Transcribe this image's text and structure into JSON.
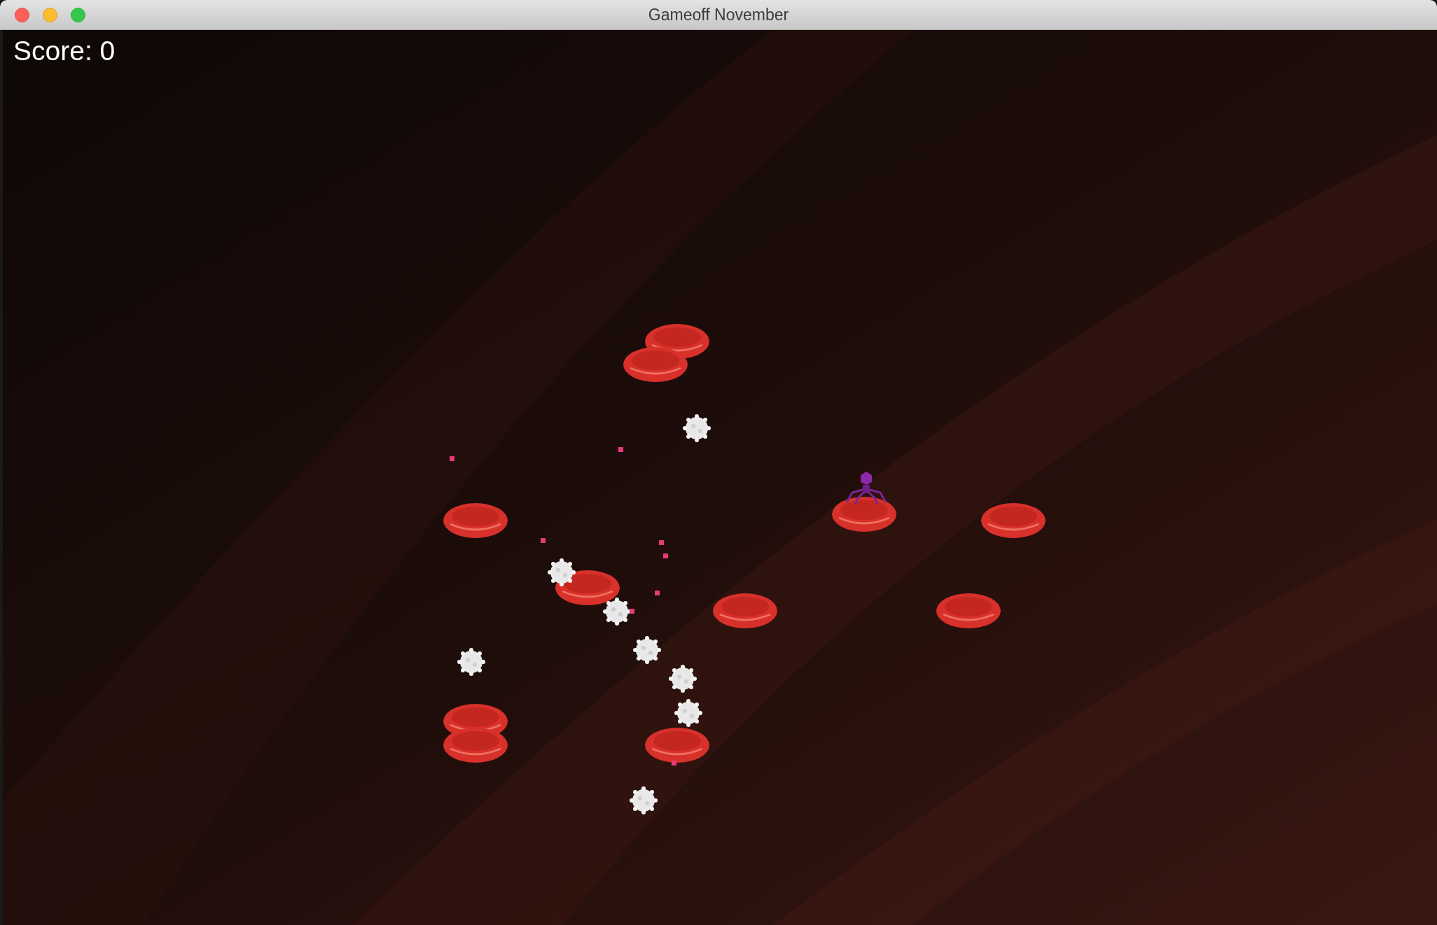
{
  "window": {
    "title": "Gameoff November"
  },
  "hud": {
    "score": "Score: 0"
  }
}
